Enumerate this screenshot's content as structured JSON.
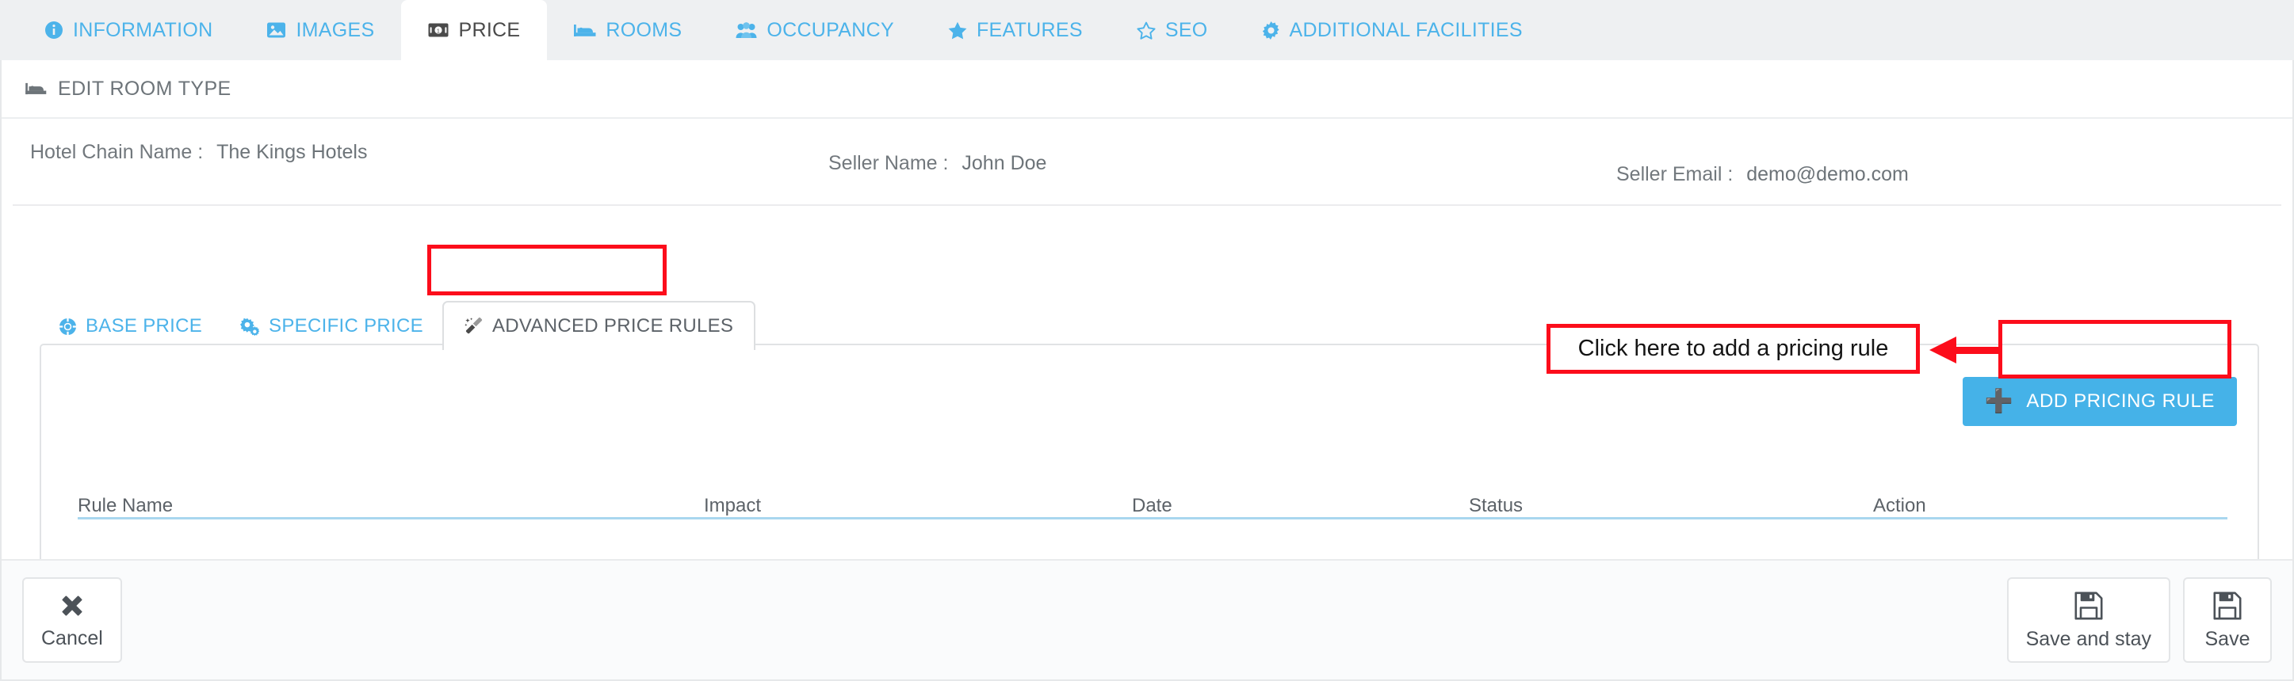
{
  "top_tabs": [
    {
      "label": "INFORMATION",
      "icon": "info-circle-icon",
      "active": false
    },
    {
      "label": "IMAGES",
      "icon": "image-icon",
      "active": false
    },
    {
      "label": "PRICE",
      "icon": "money-bill-icon",
      "active": true
    },
    {
      "label": "ROOMS",
      "icon": "bed-icon",
      "active": false
    },
    {
      "label": "OCCUPANCY",
      "icon": "users-icon",
      "active": false
    },
    {
      "label": "FEATURES",
      "icon": "star-icon",
      "active": false
    },
    {
      "label": "SEO",
      "icon": "star-outline-icon",
      "active": false
    },
    {
      "label": "ADDITIONAL FACILITIES",
      "icon": "gear-icon",
      "active": false
    }
  ],
  "card": {
    "title": "EDIT ROOM TYPE",
    "title_icon": "bed-icon"
  },
  "info": {
    "hotel_chain_label": "Hotel Chain Name :",
    "hotel_chain_value": "The Kings Hotels",
    "seller_name_label": "Seller Name :",
    "seller_name_value": "John Doe",
    "seller_email_label": "Seller Email :",
    "seller_email_value": "demo@demo.com"
  },
  "sub_tabs": [
    {
      "label": "BASE PRICE",
      "icon": "lifebuoy-icon",
      "active": false
    },
    {
      "label": "SPECIFIC PRICE",
      "icon": "gears-icon",
      "active": false
    },
    {
      "label": "ADVANCED PRICE RULES",
      "icon": "wand-icon",
      "active": true
    }
  ],
  "panel": {
    "add_button_label": "ADD PRICING RULE",
    "add_button_icon": "plus-icon",
    "table": {
      "columns": [
        "Rule Name",
        "Impact",
        "Date",
        "Status",
        "Action"
      ],
      "rows": []
    }
  },
  "annotation": {
    "callout_text": "Click here to add a pricing rule",
    "arrow_icon": "arrow-left-icon",
    "color": "#fc0d1b"
  },
  "footer": {
    "cancel_label": "Cancel",
    "cancel_icon": "close-icon",
    "save_and_stay_label": "Save and stay",
    "save_and_stay_icon": "floppy-disk-icon",
    "save_label": "Save",
    "save_icon": "floppy-disk-icon"
  },
  "colors": {
    "accent_blue": "#4cb3ea",
    "button_blue": "#45b2e8",
    "annotation_red": "#fc0d1b",
    "tabstrip_bg": "#eef0f2",
    "footer_bg": "#fafbfc",
    "text_gray": "#6d7479"
  }
}
